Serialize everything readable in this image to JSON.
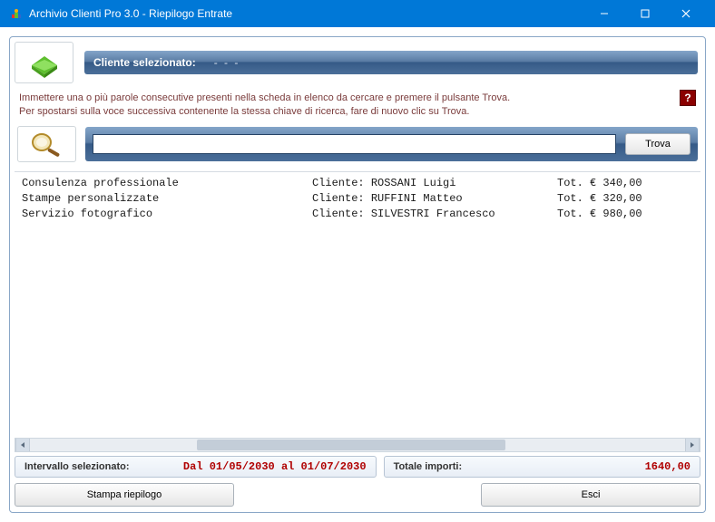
{
  "title": "Archivio Clienti Pro 3.0 - Riepilogo Entrate",
  "header": {
    "label": "Cliente selezionato:",
    "value": "- - -"
  },
  "instructions": {
    "line1": "Immettere una o più parole consecutive presenti nella scheda in elenco da cercare e premere il pulsante Trova.",
    "line2": "Per spostarsi sulla voce successiva contenente la stessa chiave di ricerca, fare di nuovo clic su Trova."
  },
  "search": {
    "value": "",
    "button": "Trova"
  },
  "rows": [
    {
      "service": "Consulenza professionale",
      "client_lbl": "Cliente:",
      "client_name": "ROSSANI Luigi",
      "tot_lbl": "Tot. €",
      "amount": "340,00"
    },
    {
      "service": "Stampe personalizzate",
      "client_lbl": "Cliente:",
      "client_name": "RUFFINI Matteo",
      "tot_lbl": "Tot. €",
      "amount": "320,00"
    },
    {
      "service": "Servizio fotografico",
      "client_lbl": "Cliente:",
      "client_name": "SILVESTRI Francesco",
      "tot_lbl": "Tot. €",
      "amount": "980,00"
    }
  ],
  "interval": {
    "label": "Intervallo selezionato:",
    "value": "Dal  01/05/2030  al  01/07/2030"
  },
  "totals": {
    "label": "Totale importi:",
    "value": "1640,00"
  },
  "buttons": {
    "print": "Stampa riepilogo",
    "exit": "Esci"
  }
}
